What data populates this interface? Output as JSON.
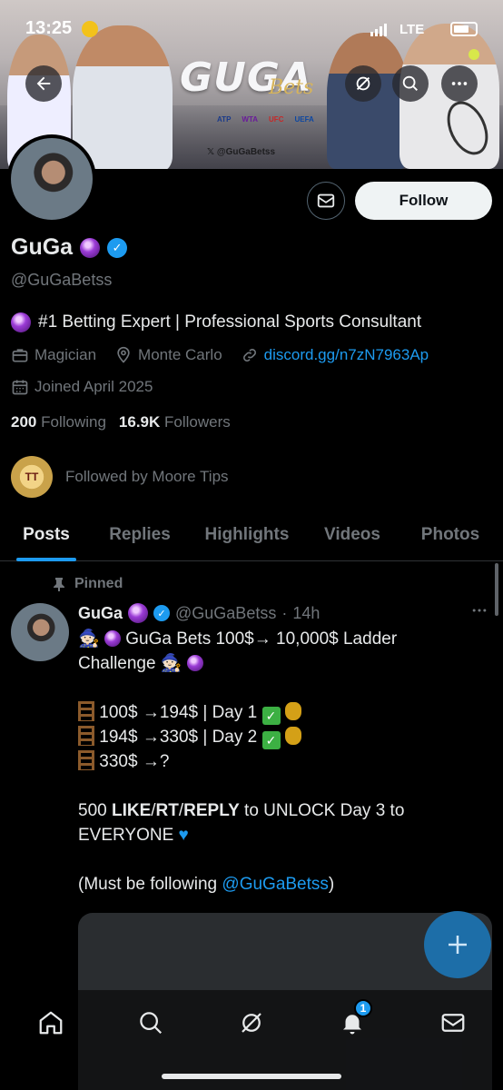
{
  "status_bar": {
    "time": "13:25",
    "network": "LTE"
  },
  "banner": {
    "logo_text": "GUGA",
    "logo_script": "Bets",
    "sponsors": [
      "ATP",
      "WTA",
      "UFC",
      "UEFA"
    ],
    "x_handle": "@GuGaBetss"
  },
  "profile": {
    "name": "GuGa",
    "handle": "@GuGaBetss",
    "bio": "#1 Betting Expert | Professional Sports Consultant",
    "profession": "Magician",
    "location": "Monte Carlo",
    "link": "discord.gg/n7zN7963Ap",
    "joined": "Joined April 2025",
    "following_count": "200",
    "following_label": "Following",
    "followers_count": "16.9K",
    "followers_label": "Followers",
    "followed_by": "Followed by Moore Tips",
    "follow_button": "Follow"
  },
  "tabs": [
    {
      "label": "Posts",
      "active": true
    },
    {
      "label": "Replies",
      "active": false
    },
    {
      "label": "Highlights",
      "active": false
    },
    {
      "label": "Videos",
      "active": false
    },
    {
      "label": "Photos",
      "active": false
    }
  ],
  "post": {
    "pinned_label": "Pinned",
    "author_name": "GuGa",
    "author_handle": "@GuGaBetss",
    "time": "14h",
    "line1": "GuGa Bets 100$→ 10,000$ Ladder",
    "line2": "Challenge",
    "ladder1": "100$ →194$ | Day 1",
    "ladder2": "194$ →330$ | Day 2",
    "ladder3": "330$ →?",
    "cta_prefix": "500 ",
    "cta_like": "LIKE",
    "cta_rt": "RT",
    "cta_reply": "REPLY",
    "cta_suffix": " to UNLOCK Day 3 to",
    "cta_line2": "EVERYONE",
    "note_prefix": "(Must be following ",
    "note_mention": "@GuGaBetss",
    "note_suffix": ")"
  },
  "nav": {
    "notification_count": "1"
  },
  "colors": {
    "accent": "#1d9bf0",
    "background": "#000000",
    "muted": "#71767b"
  }
}
